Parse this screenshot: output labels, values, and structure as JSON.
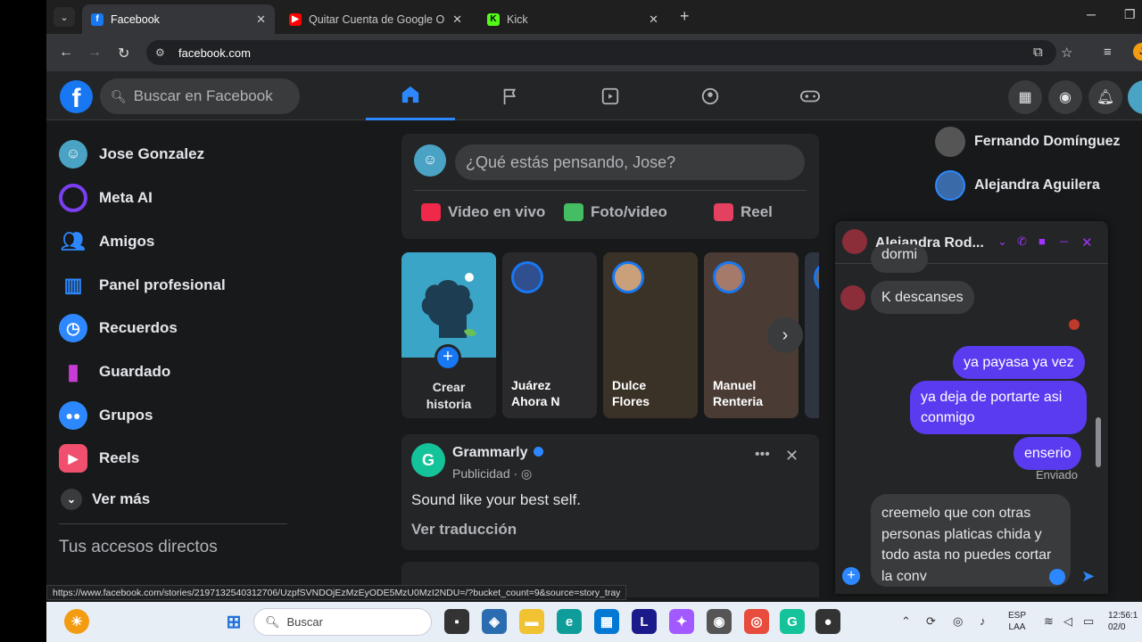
{
  "browser": {
    "tabs": [
      {
        "title": "Facebook",
        "icon": "facebook-icon"
      },
      {
        "title": "Quitar Cuenta de Google Olvid",
        "icon": "youtube-icon"
      },
      {
        "title": "Kick",
        "icon": "kick-icon"
      }
    ],
    "url": "facebook.com",
    "status_url": "https://www.facebook.com/stories/2197132540312706/UzpfSVNDOjEzMzEyODE5MzU0MzI2NDU=/?bucket_count=9&source=story_tray"
  },
  "fb": {
    "search_placeholder": "Buscar en Facebook",
    "logo_letter": "f"
  },
  "sidebar": {
    "items": [
      {
        "label": "Jose Gonzalez",
        "icon": "profile-avatar",
        "color": "#4aa3c4"
      },
      {
        "label": "Meta AI",
        "icon": "meta-ai-icon",
        "color": "#7b3ff2"
      },
      {
        "label": "Amigos",
        "icon": "friends-icon",
        "color": "#2d88ff"
      },
      {
        "label": "Panel profesional",
        "icon": "dashboard-icon",
        "color": "#2d88ff"
      },
      {
        "label": "Recuerdos",
        "icon": "clock-icon",
        "color": "#2d88ff"
      },
      {
        "label": "Guardado",
        "icon": "bookmark-icon",
        "color": "#c73bd6"
      },
      {
        "label": "Grupos",
        "icon": "groups-icon",
        "color": "#2d88ff"
      },
      {
        "label": "Reels",
        "icon": "reels-icon",
        "color": "#f0506e"
      },
      {
        "label": "Ver más",
        "icon": "chevron-down-icon",
        "color": "#3a3b3c"
      }
    ],
    "shortcuts_title": "Tus accesos directos"
  },
  "composer": {
    "placeholder": "¿Qué estás pensando, Jose?",
    "actions": [
      {
        "label": "Video en vivo",
        "color": "#f02849"
      },
      {
        "label": "Foto/video",
        "color": "#45bd62"
      },
      {
        "label": "Reel",
        "color": "#e4405f"
      }
    ]
  },
  "stories": {
    "create_label_1": "Crear",
    "create_label_2": "historia",
    "items": [
      {
        "line1": "Juárez",
        "line2": "Ahora N",
        "bg": "#2a2a2c"
      },
      {
        "line1": "Dulce",
        "line2": "Flores",
        "bg": "#3b3227"
      },
      {
        "line1": "Manuel",
        "line2": "Renteria",
        "bg": "#4a3c35"
      }
    ]
  },
  "post": {
    "name": "Grammarly",
    "sub": "Publicidad · ◎",
    "text": "Sound like your best self.",
    "translate": "Ver traducción",
    "logo_letter": "G"
  },
  "contacts": [
    {
      "name": "Fernando Domínguez",
      "color": "#555"
    },
    {
      "name": "Alejandra Aguilera",
      "color": "#3a6aa8"
    }
  ],
  "chat": {
    "name": "Alejandra Rod...",
    "partial_top": "dormi",
    "messages_in": [
      "K descanses"
    ],
    "messages_out": [
      "ya payasa ya vez",
      "ya deja de portarte asi conmigo",
      "enserio"
    ],
    "sent_label": "Enviado",
    "draft": "creemelo que con otras personas platicas chida y todo asta no puedes cortar la conv"
  },
  "taskbar": {
    "search_placeholder": "Buscar",
    "lang_1": "ESP",
    "lang_2": "LAA",
    "time": "12:56:1",
    "date": "02/0"
  }
}
